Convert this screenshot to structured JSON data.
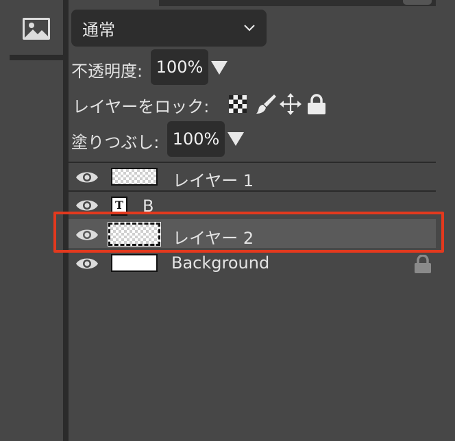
{
  "blend_mode": {
    "value": "通常"
  },
  "opacity": {
    "label": "不透明度:",
    "value": "100%"
  },
  "lock": {
    "label": "レイヤーをロック:"
  },
  "fill": {
    "label": "塗りつぶし:",
    "value": "100%"
  },
  "layers": [
    {
      "name": "レイヤー 1",
      "thumb": "transparent",
      "selected": false,
      "locked": false
    },
    {
      "name": "B",
      "thumb": "text",
      "thumb_label": "T",
      "selected": false,
      "locked": false
    },
    {
      "name": "レイヤー 2",
      "thumb": "transparent",
      "selected": true,
      "locked": false
    },
    {
      "name": "Background",
      "thumb": "white",
      "selected": false,
      "locked": true
    }
  ],
  "colors": {
    "panel_bg": "#474747",
    "dark_bg": "#2d2d2d",
    "selected_row": "#5a5a5a",
    "highlight": "#e3391e"
  },
  "icons": [
    "image-icon",
    "chevron-down-icon",
    "dropdown-triangle-icon",
    "checkerboard-lock-icon",
    "brush-lock-icon",
    "move-lock-icon",
    "padlock-icon",
    "eye-icon",
    "lock-icon"
  ]
}
